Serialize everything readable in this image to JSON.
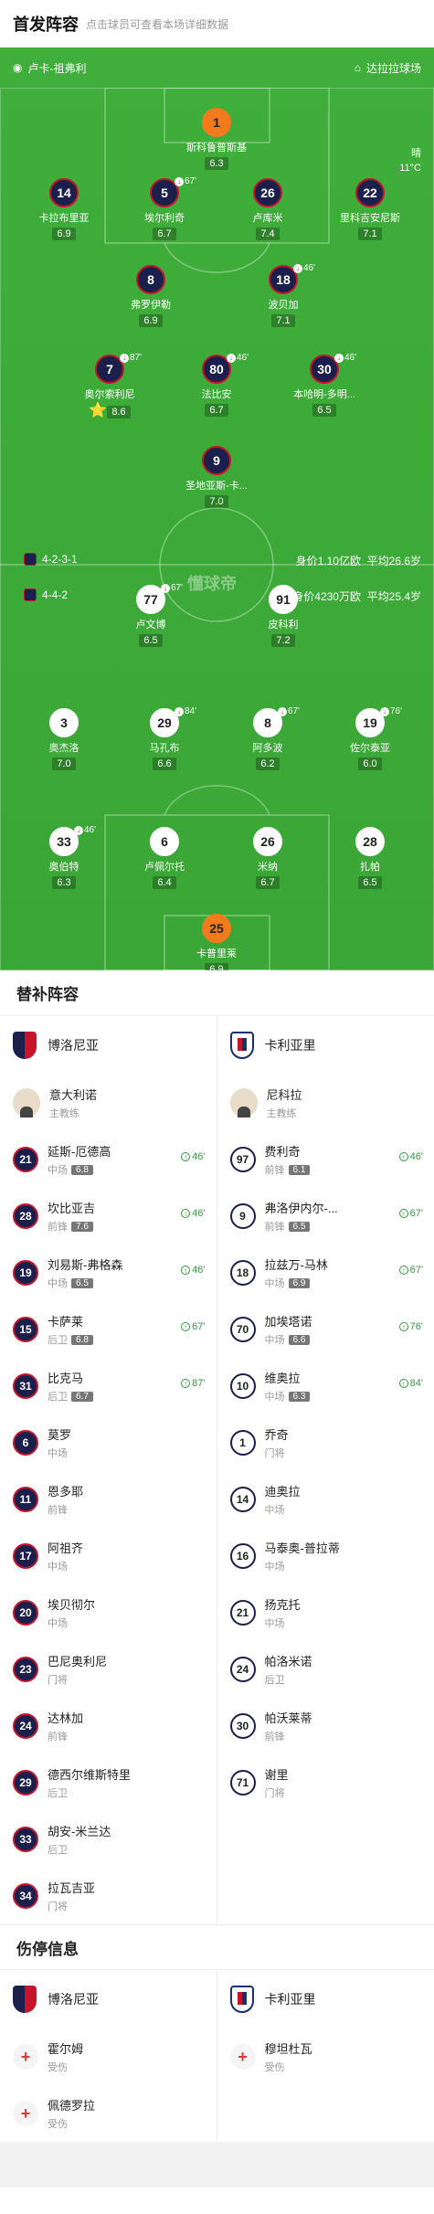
{
  "header": {
    "title": "首发阵容",
    "subtitle": "点击球员可查看本场详细数据"
  },
  "match": {
    "home_coach": "卢卡-祖弗利",
    "venue": "达拉拉球场",
    "weather": "晴",
    "temp": "11°C",
    "home_formation": "4-2-3-1",
    "away_formation": "4-4-2",
    "home_value": "身价1.10亿欧",
    "home_age": "平均26.6岁",
    "away_value": "身价4230万欧",
    "away_age": "平均25.4岁",
    "watermark": "懂球帝"
  },
  "home_players": [
    {
      "num": "1",
      "name": "斯科鲁普斯基",
      "rating": "6.3",
      "gk": true
    },
    {
      "num": "14",
      "name": "卡拉布里亚",
      "rating": "6.9"
    },
    {
      "num": "5",
      "name": "埃尔利奇",
      "rating": "6.7",
      "sub": "67'"
    },
    {
      "num": "26",
      "name": "卢库米",
      "rating": "7.4"
    },
    {
      "num": "22",
      "name": "里科吉安尼斯",
      "rating": "7.1"
    },
    {
      "num": "8",
      "name": "弗罗伊勒",
      "rating": "6.9"
    },
    {
      "num": "18",
      "name": "波贝加",
      "rating": "7.1",
      "sub": "46'"
    },
    {
      "num": "7",
      "name": "奥尔索利尼",
      "rating": "8.6",
      "sub": "87'",
      "star": "⭐"
    },
    {
      "num": "80",
      "name": "法比安",
      "rating": "6.7",
      "sub": "46'"
    },
    {
      "num": "30",
      "name": "本哈明-多明...",
      "rating": "6.5",
      "sub": "46'"
    },
    {
      "num": "9",
      "name": "圣地亚斯-卡...",
      "rating": "7.0"
    }
  ],
  "away_players": [
    {
      "num": "77",
      "name": "卢文博",
      "rating": "6.5",
      "sub": "67'"
    },
    {
      "num": "91",
      "name": "皮科利",
      "rating": "7.2"
    },
    {
      "num": "3",
      "name": "奥杰洛",
      "rating": "7.0"
    },
    {
      "num": "29",
      "name": "马孔布",
      "rating": "6.6",
      "sub": "84'"
    },
    {
      "num": "8",
      "name": "阿多波",
      "rating": "6.2",
      "sub": "67'"
    },
    {
      "num": "19",
      "name": "佐尔泰亚",
      "rating": "6.0",
      "sub": "76'"
    },
    {
      "num": "33",
      "name": "奥伯特",
      "rating": "6.3",
      "sub": "46'"
    },
    {
      "num": "6",
      "name": "卢佩尔托",
      "rating": "6.4"
    },
    {
      "num": "26",
      "name": "米纳",
      "rating": "6.7"
    },
    {
      "num": "28",
      "name": "扎帕",
      "rating": "6.5"
    },
    {
      "num": "25",
      "name": "卡普里莱",
      "rating": "6.9",
      "gk": true
    }
  ],
  "subs": {
    "title": "替补阵容",
    "home_team": "博洛尼亚",
    "away_team": "卡利亚里",
    "home_coach": {
      "name": "意大利诺",
      "role": "主教练"
    },
    "away_coach": {
      "name": "尼科拉",
      "role": "主教练"
    },
    "home": [
      {
        "num": "21",
        "name": "延斯-厄德高",
        "pos": "中场",
        "rating": "6.8",
        "time": "46'"
      },
      {
        "num": "28",
        "name": "坎比亚吉",
        "pos": "前锋",
        "rating": "7.6",
        "time": "46'"
      },
      {
        "num": "19",
        "name": "刘易斯-弗格森",
        "pos": "中场",
        "rating": "6.5",
        "time": "46'"
      },
      {
        "num": "15",
        "name": "卡萨莱",
        "pos": "后卫",
        "rating": "6.8",
        "time": "67'"
      },
      {
        "num": "31",
        "name": "比克马",
        "pos": "后卫",
        "rating": "6.7",
        "time": "87'"
      },
      {
        "num": "6",
        "name": "莫罗",
        "pos": "中场"
      },
      {
        "num": "11",
        "name": "恩多耶",
        "pos": "前锋"
      },
      {
        "num": "17",
        "name": "阿祖齐",
        "pos": "中场"
      },
      {
        "num": "20",
        "name": "埃贝彻尔",
        "pos": "中场"
      },
      {
        "num": "23",
        "name": "巴尼奥利尼",
        "pos": "门将"
      },
      {
        "num": "24",
        "name": "达林加",
        "pos": "前锋"
      },
      {
        "num": "29",
        "name": "德西尔维斯特里",
        "pos": "后卫"
      },
      {
        "num": "33",
        "name": "胡安-米兰达",
        "pos": "后卫"
      },
      {
        "num": "34",
        "name": "拉瓦吉亚",
        "pos": "门将"
      }
    ],
    "away": [
      {
        "num": "97",
        "name": "费利奇",
        "pos": "前锋",
        "rating": "6.1",
        "time": "46'"
      },
      {
        "num": "9",
        "name": "弗洛伊内尔-...",
        "pos": "前锋",
        "rating": "6.5",
        "time": "67'"
      },
      {
        "num": "18",
        "name": "拉兹万-马林",
        "pos": "中场",
        "rating": "6.9",
        "time": "67'"
      },
      {
        "num": "70",
        "name": "加埃塔诺",
        "pos": "中场",
        "rating": "6.6",
        "time": "76'"
      },
      {
        "num": "10",
        "name": "维奥拉",
        "pos": "中场",
        "rating": "6.3",
        "time": "84'"
      },
      {
        "num": "1",
        "name": "乔奇",
        "pos": "门将"
      },
      {
        "num": "14",
        "name": "迪奥拉",
        "pos": "中场"
      },
      {
        "num": "16",
        "name": "马泰奥-普拉蒂",
        "pos": "中场"
      },
      {
        "num": "21",
        "name": "扬克托",
        "pos": "中场"
      },
      {
        "num": "24",
        "name": "帕洛米诺",
        "pos": "后卫"
      },
      {
        "num": "30",
        "name": "帕沃莱蒂",
        "pos": "前锋"
      },
      {
        "num": "71",
        "name": "谢里",
        "pos": "门将"
      }
    ]
  },
  "injuries": {
    "title": "伤停信息",
    "home_team": "博洛尼亚",
    "away_team": "卡利亚里",
    "home": [
      {
        "name": "霍尔姆",
        "status": "受伤"
      },
      {
        "name": "佩德罗拉",
        "status": "受伤"
      }
    ],
    "away": [
      {
        "name": "穆坦杜瓦",
        "status": "受伤"
      }
    ]
  }
}
